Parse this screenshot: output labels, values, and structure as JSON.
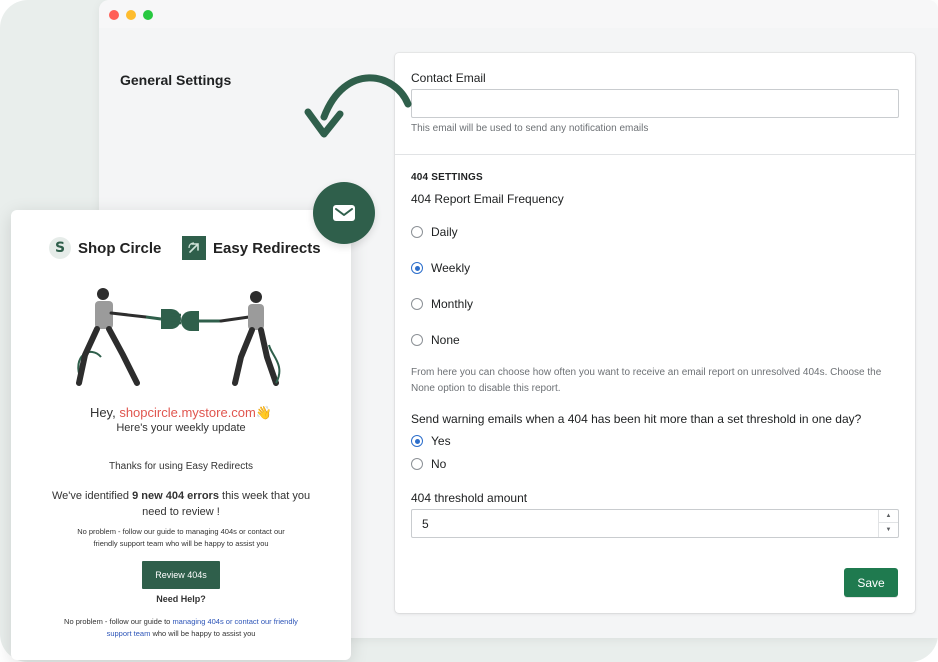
{
  "settings": {
    "section_title": "General Settings",
    "contact_email_label": "Contact Email",
    "contact_email_value": "",
    "contact_email_help": "This email will be used to send any notification emails",
    "heading_404": "404 SETTINGS",
    "frequency_label": "404 Report Email Frequency",
    "frequency_options": [
      "Daily",
      "Weekly",
      "Monthly",
      "None"
    ],
    "frequency_selected": "Weekly",
    "frequency_help": "From here you can choose how often you want to receive an email report on unresolved 404s. Choose the None option to disable this report.",
    "warning_label": "Send warning emails when a 404 has been hit more than a set threshold in one day?",
    "warning_options": [
      "Yes",
      "No"
    ],
    "warning_selected": "Yes",
    "threshold_label": "404 threshold amount",
    "threshold_value": "5",
    "save_label": "Save"
  },
  "email": {
    "brand_shopcircle": "Shop Circle",
    "brand_easyredirects": "Easy Redirects",
    "hey_prefix": "Hey, ",
    "store": "shopcircle.mystore.com",
    "wave": "👋",
    "weekly_update": "Here's your weekly update",
    "thanks": "Thanks for using Easy Redirects",
    "identified_prefix": "We've identified ",
    "identified_count": "9 new 404 errors",
    "identified_suffix": " this week that you need to review !",
    "guide1": "No problem - follow our guide to managing 404s or contact our friendly support team who will be happy to assist you",
    "review_button": "Review 404s",
    "need_help": "Need Help?",
    "guide2_prefix": "No problem - follow our guide to ",
    "guide2_link1": "managing 404s or contact our friendly support team",
    "guide2_suffix": " who will be happy to assist you"
  },
  "colors": {
    "primary_green": "#1f7a4f",
    "brand_dark_green": "#2f5f4b",
    "radio_blue": "#2c6ecb",
    "store_red": "#e0564f",
    "link_blue": "#2d55b8"
  },
  "icons": {
    "arrow": "curved-arrow-icon",
    "mail": "mail-icon"
  }
}
